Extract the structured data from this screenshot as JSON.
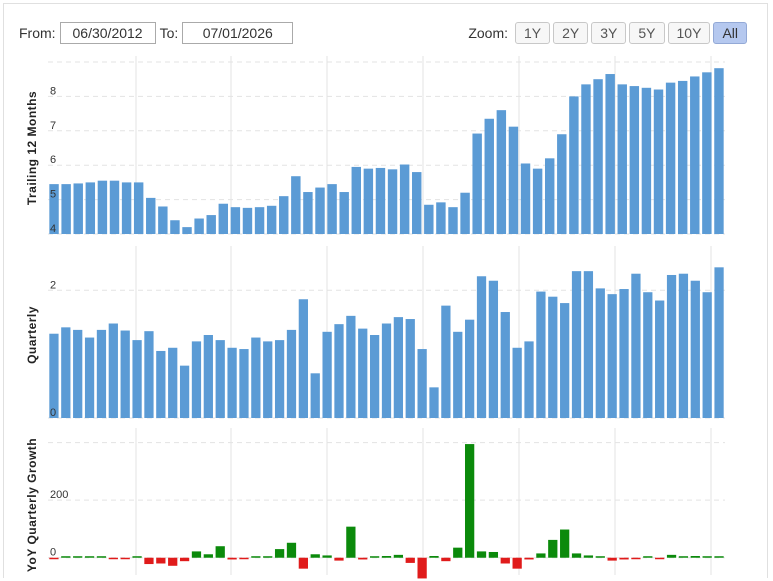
{
  "controls": {
    "from_label": "From:",
    "from_value": "06/30/2012",
    "to_label": "To:",
    "to_value": "07/01/2026",
    "zoom_label": "Zoom:",
    "zoom_buttons": [
      "1Y",
      "2Y",
      "3Y",
      "5Y",
      "10Y",
      "All"
    ],
    "zoom_active": "All"
  },
  "colors": {
    "bar": "#5b9bd5",
    "positive": "#0b8a0b",
    "negative": "#e01b1b",
    "grid": "#e3e3e3"
  },
  "chart_data": [
    {
      "type": "bar",
      "ylabel": "Trailing 12 Months",
      "ylim": [
        4,
        9
      ],
      "ticks": [
        4,
        5,
        6,
        7,
        8
      ],
      "tick_labels": [
        "4",
        "5",
        "6",
        "7",
        "8"
      ],
      "values": [
        5.45,
        5.45,
        5.47,
        5.5,
        5.55,
        5.55,
        5.5,
        5.5,
        5.05,
        4.8,
        4.4,
        4.2,
        4.45,
        4.55,
        4.88,
        4.78,
        4.76,
        4.78,
        4.82,
        5.1,
        5.68,
        5.22,
        5.35,
        5.45,
        5.22,
        5.95,
        5.9,
        5.92,
        5.88,
        6.02,
        5.8,
        4.85,
        4.92,
        4.78,
        5.2,
        6.92,
        7.35,
        7.6,
        7.12,
        6.05,
        5.9,
        6.2,
        6.9,
        8.0,
        8.35,
        8.5,
        8.65,
        8.35,
        8.3,
        8.25,
        8.2,
        8.4,
        8.45,
        8.58,
        8.7,
        8.82
      ]
    },
    {
      "type": "bar",
      "ylabel": "Quarterly",
      "ylim": [
        0,
        2.6
      ],
      "ticks": [
        0,
        2
      ],
      "tick_labels": [
        "0",
        "2"
      ],
      "values": [
        1.32,
        1.42,
        1.38,
        1.26,
        1.38,
        1.48,
        1.37,
        1.22,
        1.36,
        1.05,
        1.1,
        0.82,
        1.2,
        1.3,
        1.22,
        1.1,
        1.08,
        1.26,
        1.2,
        1.22,
        1.38,
        1.86,
        0.7,
        1.35,
        1.47,
        1.6,
        1.4,
        1.3,
        1.48,
        1.58,
        1.55,
        1.08,
        0.48,
        1.76,
        1.35,
        1.54,
        2.22,
        2.15,
        1.66,
        1.1,
        1.2,
        1.98,
        1.9,
        1.8,
        2.3,
        2.3,
        2.03,
        1.94,
        2.02,
        2.26,
        1.97,
        1.84,
        2.24,
        2.26,
        2.15,
        1.97,
        2.36
      ]
    },
    {
      "type": "bar",
      "ylabel": "YoY Quarterly Growth",
      "ylim": [
        -60,
        430
      ],
      "ticks": [
        0,
        200
      ],
      "tick_labels": [
        "0",
        "200"
      ],
      "values": [
        -3,
        2,
        3,
        5,
        4,
        -4,
        -4,
        0,
        -22,
        -20,
        -28,
        -12,
        22,
        12,
        40,
        -6,
        -5,
        0,
        4,
        30,
        52,
        -38,
        12,
        8,
        -10,
        108,
        -6,
        0,
        6,
        10,
        -18,
        -72,
        6,
        -12,
        35,
        395,
        22,
        20,
        -20,
        -38,
        -6,
        15,
        62,
        98,
        15,
        8,
        5,
        -10,
        -6,
        -3,
        2,
        -3,
        10,
        4,
        6,
        4,
        2
      ]
    }
  ]
}
